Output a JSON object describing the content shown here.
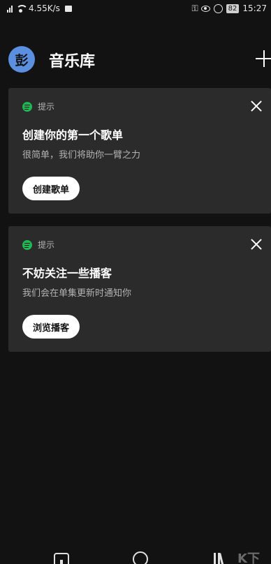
{
  "status_bar": {
    "network_speed": "4.55K/s",
    "battery": "82",
    "time": "15:27"
  },
  "header": {
    "avatar_letter": "彭",
    "title": "音乐库"
  },
  "cards": [
    {
      "tag": "提示",
      "title": "创建你的第一个歌单",
      "subtitle": "很简单，我们将助你一臂之力",
      "button_label": "创建歌单"
    },
    {
      "tag": "提示",
      "title": "不妨关注一些播客",
      "subtitle": "我们会在单集更新时通知你",
      "button_label": "浏览播客"
    }
  ],
  "watermark": "K下"
}
